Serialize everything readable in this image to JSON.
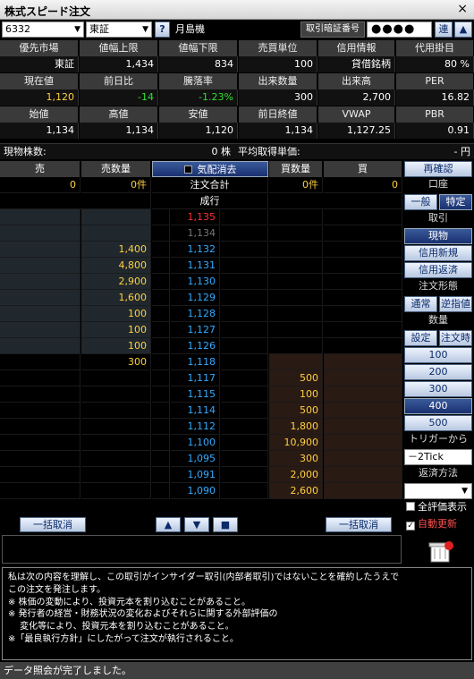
{
  "window": {
    "title": "株式スピード注文",
    "close": "×"
  },
  "toolbar": {
    "code": "6332",
    "market": "東証",
    "help": "?",
    "name": "月島機",
    "pw_label": "取引暗証番号",
    "pw_value": "●●●●",
    "link": "連",
    "up": "▲"
  },
  "info_rows": [
    {
      "headers": [
        "優先市場",
        "値幅上限",
        "値幅下限",
        "売買単位",
        "信用情報",
        "代用掛目"
      ],
      "values": [
        "東証",
        "1,434",
        "834",
        "100",
        "貸借銘柄",
        "80 %"
      ]
    },
    {
      "headers": [
        "現在値",
        "前日比",
        "騰落率",
        "出来数量",
        "出来高",
        "PER"
      ],
      "values": [
        "1,120",
        "-14",
        "-1.23%",
        "300",
        "2,700",
        "16.82"
      ]
    },
    {
      "headers": [
        "始値",
        "高値",
        "安値",
        "前日終値",
        "VWAP",
        "PBR"
      ],
      "values": [
        "1,134",
        "1,134",
        "1,120",
        "1,134",
        "1,127.25",
        "0.91"
      ]
    }
  ],
  "position": {
    "label": "現物株数:",
    "value": "0 株",
    "avg_label": "平均取得単価:",
    "avg_value": "- 円"
  },
  "book_header": {
    "sell": "売",
    "sell_qty": "売数量",
    "cancel": "気配消去",
    "buy_qty": "買数量",
    "buy": "買",
    "reconfirm": "再確認"
  },
  "summary": {
    "sell": "0",
    "sell_qty": "0件",
    "total": "注文合計",
    "buy_qty": "0件",
    "buy": "0",
    "market": "成行"
  },
  "book": [
    {
      "qty": "",
      "price": "1,135",
      "bqty": "",
      "pc": "#ff3030"
    },
    {
      "qty": "",
      "price": "1,134",
      "bqty": "",
      "pc": "#777777"
    },
    {
      "qty": "1,400",
      "price": "1,132",
      "bqty": "",
      "pc": "#33aaff"
    },
    {
      "qty": "4,800",
      "price": "1,131",
      "bqty": "",
      "pc": "#33aaff"
    },
    {
      "qty": "2,900",
      "price": "1,130",
      "bqty": "",
      "pc": "#33aaff"
    },
    {
      "qty": "1,600",
      "price": "1,129",
      "bqty": "",
      "pc": "#33aaff"
    },
    {
      "qty": "100",
      "price": "1,128",
      "bqty": "",
      "pc": "#33aaff"
    },
    {
      "qty": "100",
      "price": "1,127",
      "bqty": "",
      "pc": "#33aaff"
    },
    {
      "qty": "100",
      "price": "1,126",
      "bqty": "",
      "pc": "#33aaff"
    },
    {
      "qty": "300",
      "price": "1,118",
      "bqty": "",
      "pc": "#33aaff"
    },
    {
      "qty": "",
      "price": "1,117",
      "bqty": "500",
      "pc": "#33aaff"
    },
    {
      "qty": "",
      "price": "1,115",
      "bqty": "100",
      "pc": "#33aaff"
    },
    {
      "qty": "",
      "price": "1,114",
      "bqty": "500",
      "pc": "#33aaff"
    },
    {
      "qty": "",
      "price": "1,112",
      "bqty": "1,800",
      "pc": "#33aaff"
    },
    {
      "qty": "",
      "price": "1,100",
      "bqty": "10,900",
      "pc": "#33aaff"
    },
    {
      "qty": "",
      "price": "1,095",
      "bqty": "300",
      "pc": "#33aaff"
    },
    {
      "qty": "",
      "price": "1,091",
      "bqty": "2,000",
      "pc": "#33aaff"
    },
    {
      "qty": "",
      "price": "1,090",
      "bqty": "2,600",
      "pc": "#33aaff"
    }
  ],
  "side": {
    "account": "口座",
    "general": "一般",
    "specific": "特定",
    "trade": "取引",
    "cash": "現物",
    "margin_new": "信用新規",
    "margin_close": "信用返済",
    "order_type": "注文形態",
    "normal": "通常",
    "reverse": "逆指値",
    "qty": "数量",
    "set": "設定",
    "order_time": "注文時",
    "q100": "100",
    "q200": "200",
    "q300": "300",
    "q400": "400",
    "q500": "500",
    "trigger": "トリガーから",
    "tick": "－2Tick",
    "repay": "返済方法",
    "show_eval": "全評価表示",
    "auto": "自動更新"
  },
  "bottom": {
    "cancel_all_left": "一括取消",
    "up": "▲",
    "down": "▼",
    "stop": "■",
    "cancel_all_right": "一括取消"
  },
  "notice": [
    "私は次の内容を理解し、この取引がインサイダー取引(内部者取引)ではないことを確約したうえで",
    "この注文を発注します。",
    "※ 株価の変動により、投資元本を割り込むことがあること。",
    "※ 発行者の経営・財務状況の変化およびそれらに関する外部評価の",
    "　 変化等により、投資元本を割り込むことがあること。",
    "※「最良執行方針」にしたがって注文が執行されること。"
  ],
  "status": "データ照会が完了しました。"
}
